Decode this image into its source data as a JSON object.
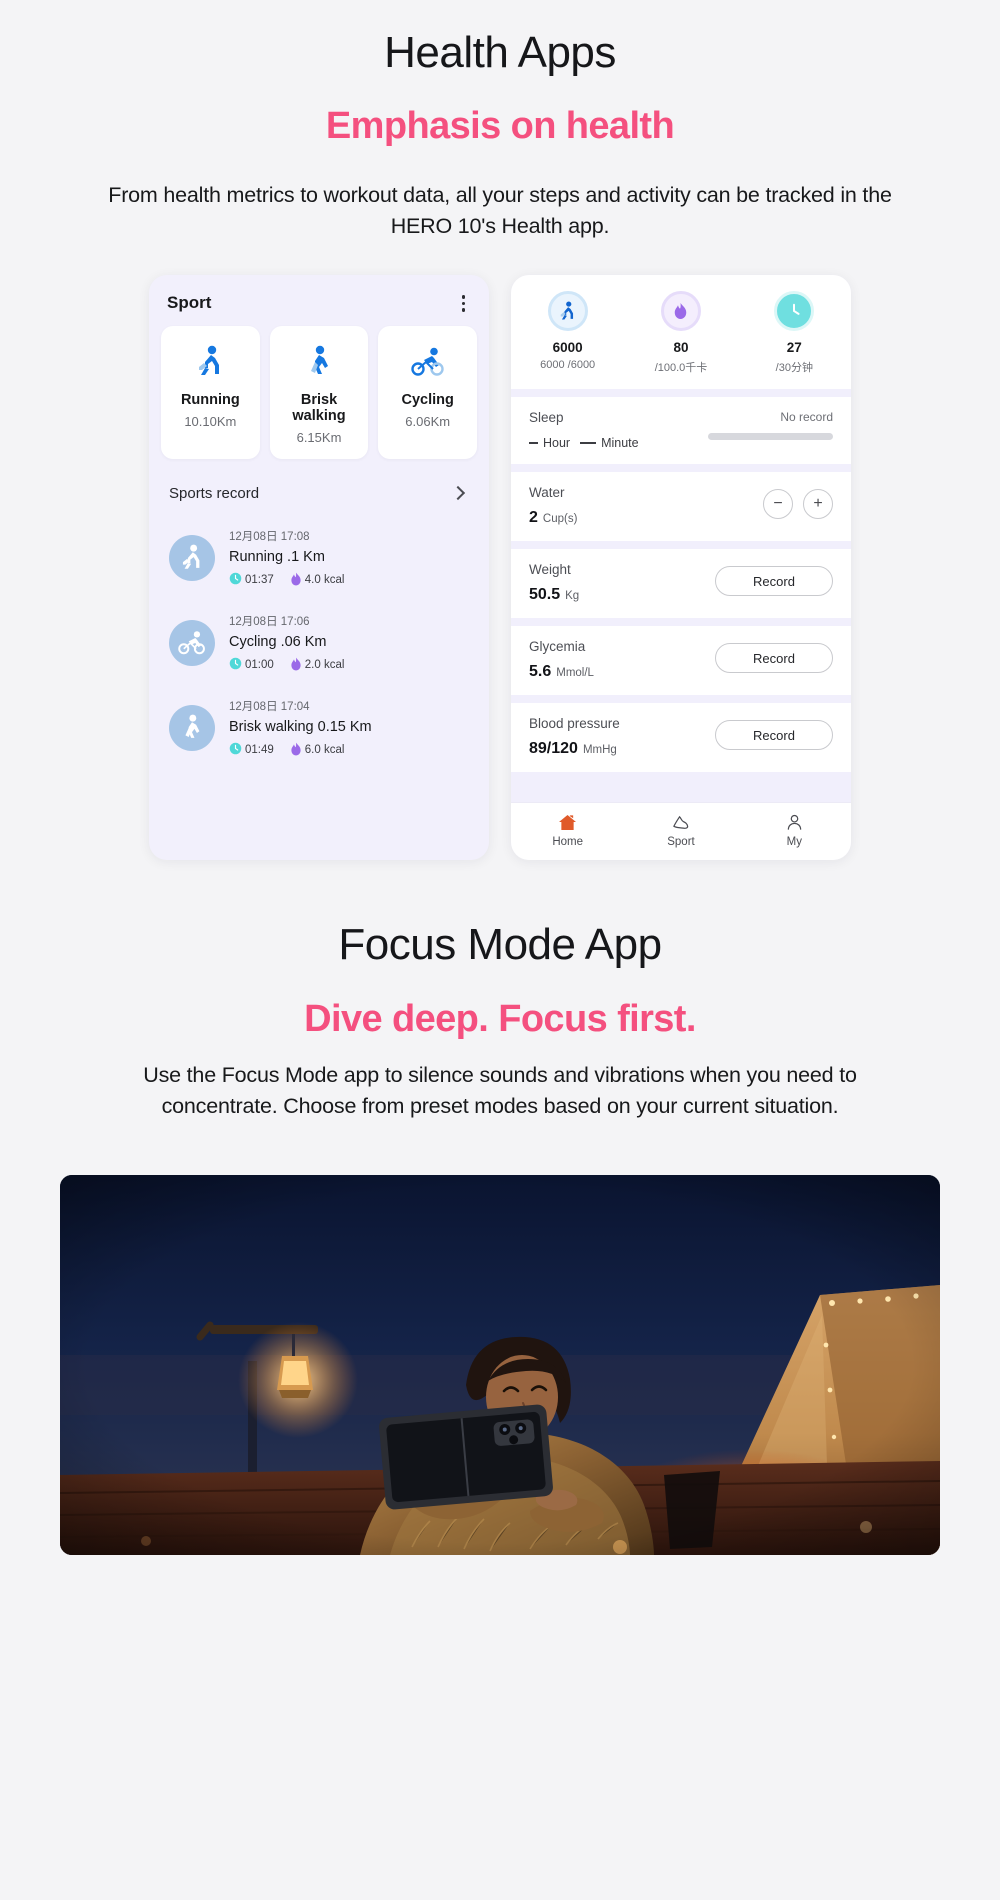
{
  "sections": {
    "health": {
      "title": "Health Apps",
      "subtitle": "Emphasis on health",
      "body": "From health metrics to workout data, all your steps and activity can be tracked in the HERO 10's Health app."
    },
    "focus": {
      "title": "Focus Mode App",
      "subtitle": "Dive deep. Focus first.",
      "body": "Use the Focus Mode app to silence sounds and vibrations when you need to concentrate. Choose from preset modes based on your current situation."
    }
  },
  "colors": {
    "accent_pink": "#f4507f",
    "page_bg": "#f4f4f6",
    "phone_bg": "#f1effc",
    "icon_blue": "#1678e0",
    "avatar_blue": "#a6c5e6",
    "clock_teal": "#4fd8d8",
    "flame_purple": "#9b6ae8"
  },
  "sport_phone": {
    "title": "Sport",
    "menu_icon": "kebab-menu-icon",
    "cards": [
      {
        "icon": "running-icon",
        "name": "Running",
        "distance": "10.10Km"
      },
      {
        "icon": "walking-icon",
        "name": "Brisk walking",
        "distance": "6.15Km"
      },
      {
        "icon": "cycling-icon",
        "name": "Cycling",
        "distance": "6.06Km"
      }
    ],
    "record_header": {
      "label": "Sports record",
      "chevron_icon": "chevron-right-icon"
    },
    "records": [
      {
        "icon": "running-icon",
        "date": "12月08日 17:08",
        "name": "Running  .1 Km",
        "duration": "01:37",
        "calories": "4.0 kcal"
      },
      {
        "icon": "cycling-icon",
        "date": "12月08日 17:06",
        "name": "Cycling  .06 Km",
        "duration": "01:00",
        "calories": "2.0 kcal"
      },
      {
        "icon": "walking-icon",
        "date": "12月08日 17:04",
        "name": "Brisk walking 0.15 Km",
        "duration": "01:49",
        "calories": "6.0 kcal"
      }
    ]
  },
  "health_phone": {
    "metrics": [
      {
        "icon": "running-icon",
        "value": "6000",
        "sub": "6000 /6000"
      },
      {
        "icon": "flame-icon",
        "value": "80",
        "sub": "/100.0千卡"
      },
      {
        "icon": "clock-icon",
        "value": "27",
        "sub": "/30分钟"
      }
    ],
    "rows": [
      {
        "label": "Sleep",
        "type": "sleep",
        "hour_label": "Hour",
        "minute_label": "Minute",
        "status": "No record"
      },
      {
        "label": "Water",
        "type": "stepper",
        "value": "2",
        "unit": "Cup(s)",
        "minus_icon": "minus-icon",
        "plus_icon": "plus-icon"
      },
      {
        "label": "Weight",
        "type": "record",
        "value": "50.5",
        "unit": "Kg",
        "button": "Record"
      },
      {
        "label": "Glycemia",
        "type": "record",
        "value": "5.6",
        "unit": "Mmol/L",
        "button": "Record"
      },
      {
        "label": "Blood pressure",
        "type": "record",
        "value": "89/120",
        "unit": "MmHg",
        "button": "Record"
      }
    ],
    "tabs": [
      {
        "icon": "home-icon",
        "label": "Home",
        "active": true
      },
      {
        "icon": "shoe-icon",
        "label": "Sport",
        "active": false
      },
      {
        "icon": "person-icon",
        "label": "My",
        "active": false
      }
    ]
  },
  "focus_image": {
    "alt": "woman lying in front of a tent at night holding a folding phone"
  }
}
